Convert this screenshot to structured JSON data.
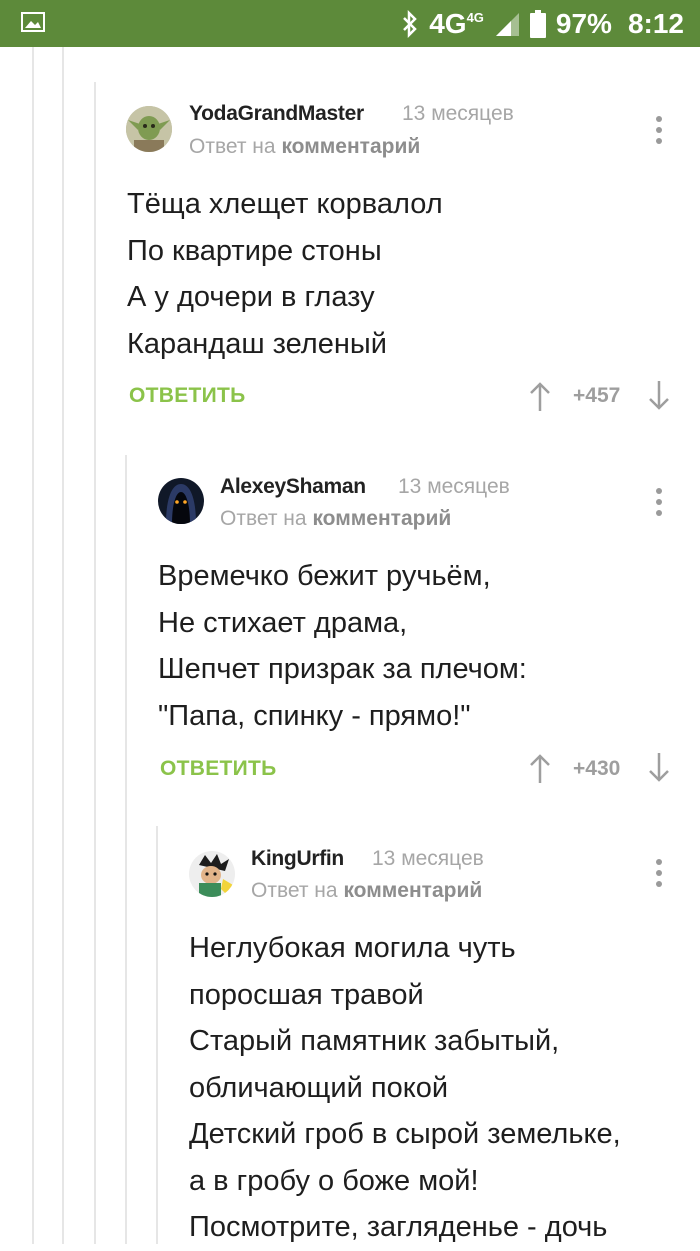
{
  "status_bar": {
    "network": "4G",
    "network_sup": "4G",
    "battery": "97%",
    "time": "8:12"
  },
  "comments": [
    {
      "username": "YodaGrandMaster",
      "time": "13 месяцев",
      "reply_prefix": "Ответ на",
      "reply_link": "комментарий",
      "lines": [
        "Тёща хлещет корвалол",
        "По квартире стоны",
        "А у дочери в глазу",
        "Карандаш зеленый"
      ],
      "reply_label": "ОТВЕТИТЬ",
      "rating": "+457"
    },
    {
      "username": "AlexeyShaman",
      "time": "13 месяцев",
      "reply_prefix": "Ответ на",
      "reply_link": "комментарий",
      "lines": [
        "Времечко бежит ручьём,",
        "Не стихает драма,",
        "Шепчет призрак за плечом:",
        "\"Папа, спинку - прямо!\""
      ],
      "reply_label": "ОТВЕТИТЬ",
      "rating": "+430"
    },
    {
      "username": "KingUrfin",
      "time": "13 месяцев",
      "reply_prefix": "Ответ на",
      "reply_link": "комментарий",
      "lines": [
        "Неглубокая могила чуть",
        "поросшая травой",
        "Старый памятник забытый,",
        "обличающий покой",
        "Детский гроб в сырой земельке,",
        "а в гробу о боже мой!",
        "Посмотрите, загляденье - дочь"
      ]
    }
  ],
  "colors": {
    "status_bar": "#5d8a3a",
    "reply_button": "#8bc34a",
    "meta_text": "#a6a6a6"
  }
}
